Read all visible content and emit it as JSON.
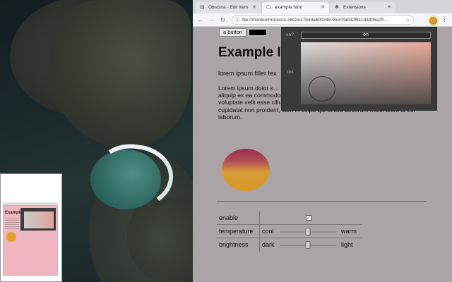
{
  "tabs": [
    {
      "title": "Obscura - Edit Item",
      "icon": "document-icon"
    },
    {
      "title": "example.html",
      "icon": "page-icon"
    },
    {
      "title": "Extensions",
      "icon": "puzzle-icon"
    }
  ],
  "omnibox": {
    "url": "file:///home/chronos/u-c602e17b4da60024678c47fab32f811d3405a70..."
  },
  "page": {
    "button_label": "a button",
    "color_well_value": "#000000",
    "title": "Example I",
    "lorem_short": "lorem ipsum filler tex",
    "lorem_long": "Lorem ipsum dolor s… eiusmod tempor incid… enim ad minim venia… nisi ut aliquip ex ea commodo consequat. Duis aute irure dolor in reprehenderit in voluptate velit esse cillum dolore eu fugiat nulla pariatur. Excepteur sint occaecat cupidatat non proident, sunt in culpa qui officia deserunt mollit anim id est laborum.",
    "controls": {
      "enable": {
        "label": "enable",
        "checked": true,
        "check_glyph": "✓"
      },
      "temperature": {
        "label": "temperature",
        "low": "cool",
        "high": "warm",
        "value": 0.5
      },
      "brightness": {
        "label": "brightness",
        "low": "dark",
        "high": "light",
        "value": 0.5
      }
    }
  },
  "popup": {
    "on_label": "on?",
    "on_button": "on",
    "tint_label": "tint",
    "tint_value": {
      "hue_fraction": 0.05,
      "saturation": 0.2,
      "lightness": 0.55
    }
  },
  "colors": {
    "page_bg": "#a9a4a6",
    "ball_top": "#9a2d4e",
    "ball_bottom": "#d99a28",
    "popup_bg": "#3a3a3a",
    "extension_icon": "#c18a2c"
  }
}
